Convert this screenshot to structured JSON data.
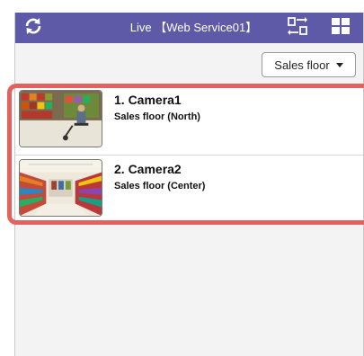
{
  "header": {
    "title": "Live 【Web Service01】",
    "refresh_icon": "refresh-icon",
    "switch_icon": "camera-switch-icon",
    "grid_icon": "grid-layout-icon",
    "background": "#5e5aa8"
  },
  "filter": {
    "selected": "Sales floor"
  },
  "cameras": [
    {
      "name": "1. Camera1",
      "location": "Sales floor (North)"
    },
    {
      "name": "2. Camera2",
      "location": "Sales floor (Center)"
    }
  ],
  "highlight_color": "#e2625f"
}
